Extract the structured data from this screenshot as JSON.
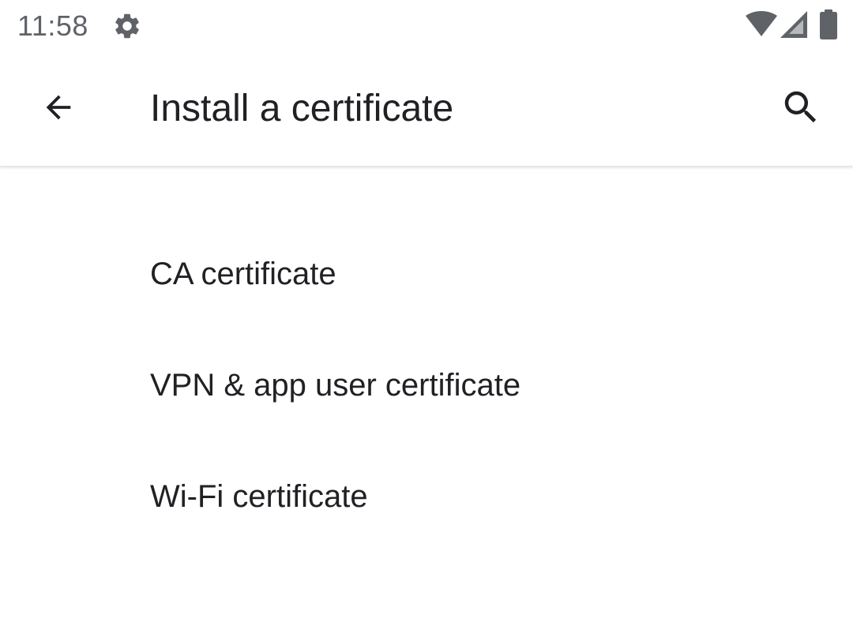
{
  "status_bar": {
    "time": "11:58",
    "icons": [
      "gear-icon",
      "wifi-icon",
      "cell-signal-icon",
      "battery-icon"
    ],
    "icon_color": "#5f6368"
  },
  "app_bar": {
    "back_icon": "arrow-left-icon",
    "title": "Install a certificate",
    "search_icon": "search-icon"
  },
  "list": {
    "items": [
      {
        "label": "CA certificate"
      },
      {
        "label": "VPN & app user certificate"
      },
      {
        "label": "Wi-Fi certificate"
      }
    ]
  },
  "colors": {
    "background": "#ffffff",
    "primary_text": "#202124",
    "status_text": "#5f6368"
  }
}
